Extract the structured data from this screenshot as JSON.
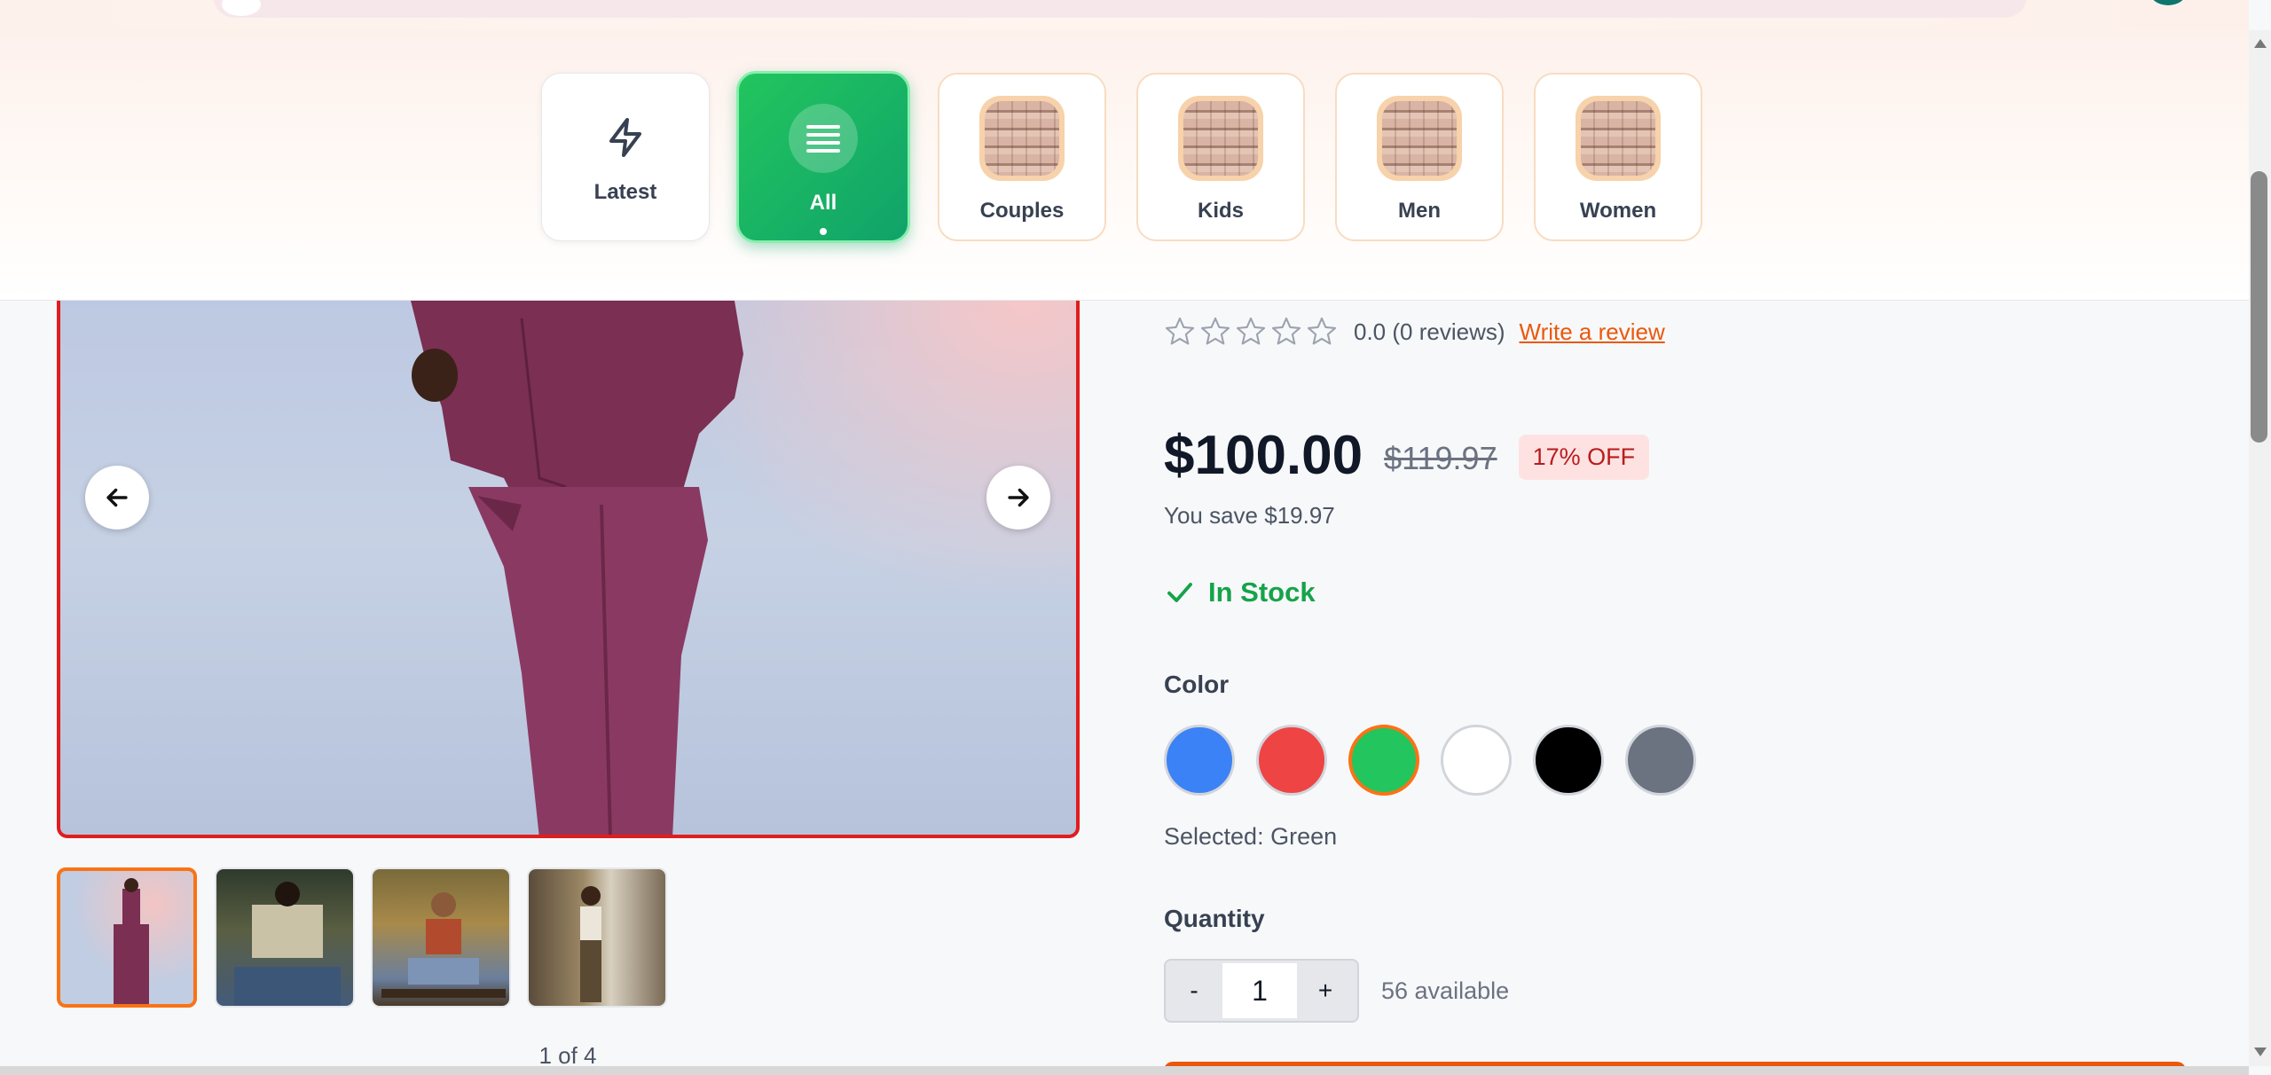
{
  "categories": [
    {
      "label": "Latest",
      "icon": "bolt-icon"
    },
    {
      "label": "All",
      "icon": "list-icon",
      "active": true
    },
    {
      "label": "Couples",
      "icon": "glasses-thumbnail"
    },
    {
      "label": "Kids",
      "icon": "glasses-thumbnail"
    },
    {
      "label": "Men",
      "icon": "glasses-thumbnail"
    },
    {
      "label": "Women",
      "icon": "glasses-thumbnail"
    }
  ],
  "gallery": {
    "counter": "1 of 4",
    "prev_icon": "arrow-left-icon",
    "next_icon": "arrow-right-icon",
    "thumbnail_count": 4,
    "active_index": 0
  },
  "product": {
    "rating_text": "0.0 (0 reviews)",
    "rating_value": 0,
    "rating_max": 5,
    "review_link": "Write a review",
    "price": "$100.00",
    "original_price": "$119.97",
    "discount": "17% OFF",
    "savings": "You save $19.97",
    "stock": "In Stock",
    "color_label": "Color",
    "colors": [
      {
        "name": "Blue",
        "hex": "#3b82f6"
      },
      {
        "name": "Red",
        "hex": "#ef4444"
      },
      {
        "name": "Green",
        "hex": "#22c55e",
        "selected": true
      },
      {
        "name": "White",
        "hex": "#ffffff"
      },
      {
        "name": "Black",
        "hex": "#000000"
      },
      {
        "name": "Gray",
        "hex": "#6b7280"
      }
    ],
    "selected_color_text": "Selected: Green",
    "quantity_label": "Quantity",
    "qty_minus": "-",
    "qty_plus": "+",
    "quantity": "1",
    "available": "56 available"
  },
  "theme": {
    "accent": "#22c55e",
    "cta": "#ea580c",
    "stock": "#16a34a",
    "discount_bg": "#fee2e2",
    "discount_text": "#b91c1c",
    "image_border": "#e11d1d"
  }
}
